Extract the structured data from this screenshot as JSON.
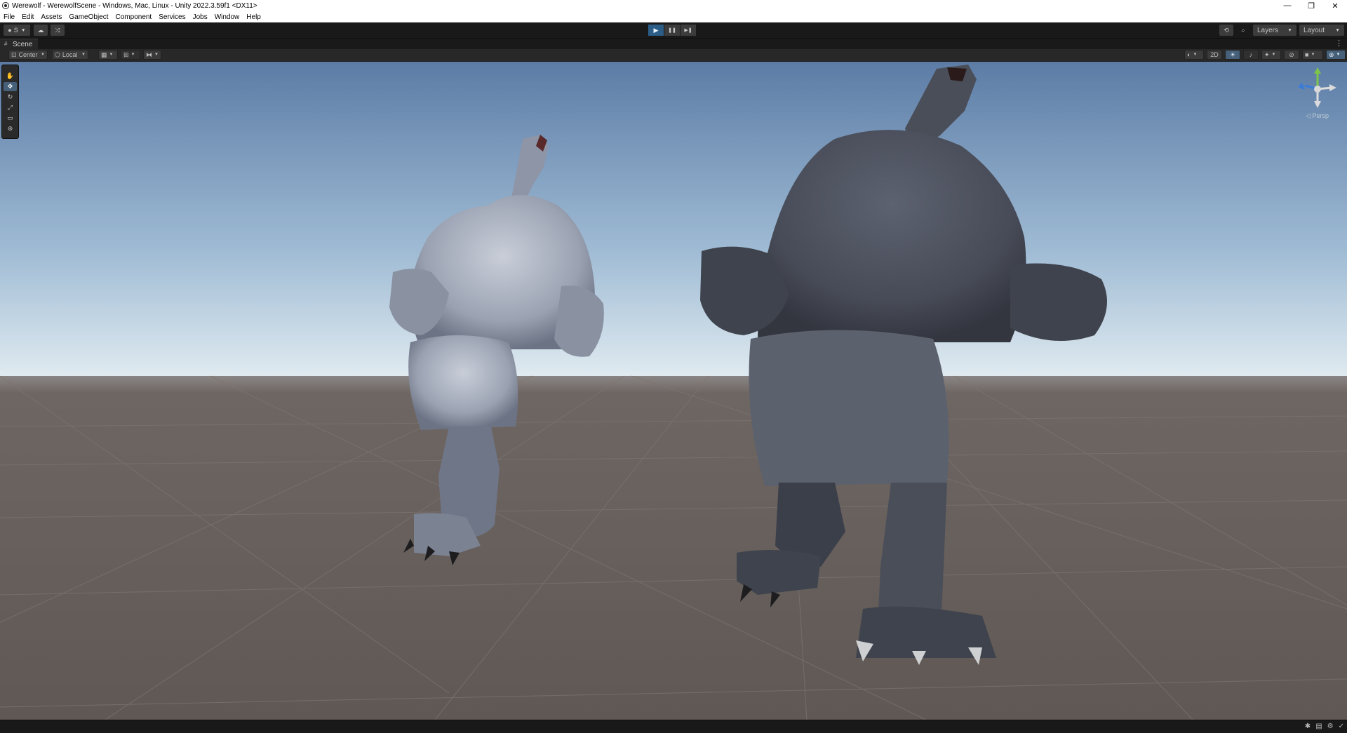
{
  "window": {
    "title": "Werewolf - WerewolfScene - Windows, Mac, Linux - Unity 2022.3.59f1 <DX11>",
    "controls": {
      "minimize": "—",
      "restore": "❐",
      "close": "✕"
    }
  },
  "menu": {
    "items": [
      "File",
      "Edit",
      "Assets",
      "GameObject",
      "Component",
      "Services",
      "Jobs",
      "Window",
      "Help"
    ]
  },
  "toolbar": {
    "account_label": "S",
    "play_icon": "▶",
    "pause_icon": "❚❚",
    "step_icon": "▶❚",
    "layers_label": "Layers",
    "layout_label": "Layout"
  },
  "scene": {
    "tab_label": "Scene",
    "pivot_label": "Center",
    "space_label": "Local",
    "mode_2d_label": "2D",
    "projection_label": "◁ Persp"
  },
  "colors": {
    "sky_top": "#5c7ca6",
    "sky_horizon": "#dfeaf0",
    "ground": "#6e6662",
    "play_active": "#2c5d87"
  },
  "icons": {
    "tools": [
      "hand-icon",
      "move-icon",
      "rotate-icon",
      "scale-icon",
      "rect-icon",
      "transform-icon"
    ],
    "status": [
      "bug-icon",
      "console-icon",
      "graph-icon",
      "check-icon"
    ]
  }
}
